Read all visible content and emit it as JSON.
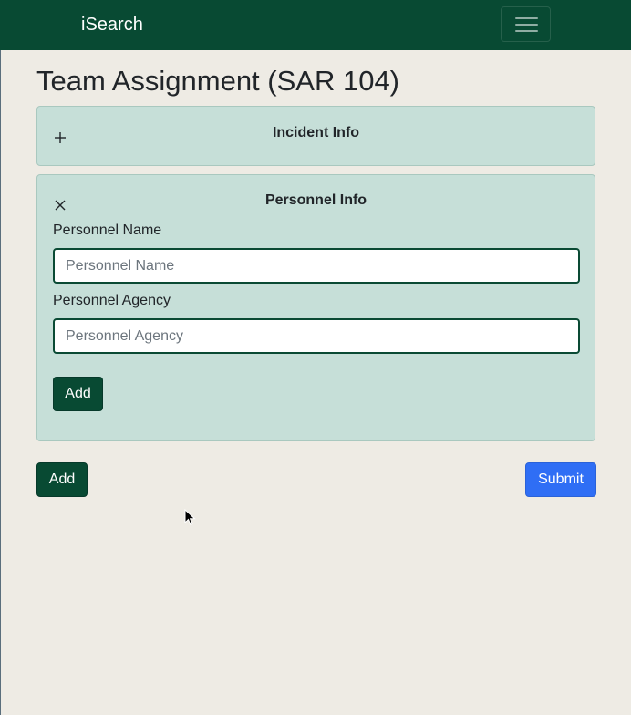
{
  "navbar": {
    "brand": "iSearch",
    "menu_icon": "hamburger-icon",
    "background_color": "#084a33"
  },
  "page": {
    "title": "Team Assignment (SAR 104)"
  },
  "incident_card": {
    "title": "Incident Info",
    "toggle_icon": "plus-icon"
  },
  "personnel_card": {
    "title": "Personnel Info",
    "toggle_icon": "close-icon",
    "name_label": "Personnel Name",
    "name_value": "",
    "name_placeholder": "Personnel Name",
    "agency_label": "Personnel Agency",
    "agency_value": "",
    "agency_placeholder": "Personnel Agency",
    "add_label": "Add"
  },
  "actions": {
    "add_label": "Add",
    "submit_label": "Submit"
  },
  "colors": {
    "primary_green": "#084a33",
    "card_background": "#c6dfd8",
    "submit_blue": "#2f6ef5",
    "page_background": "#eeebe4"
  }
}
